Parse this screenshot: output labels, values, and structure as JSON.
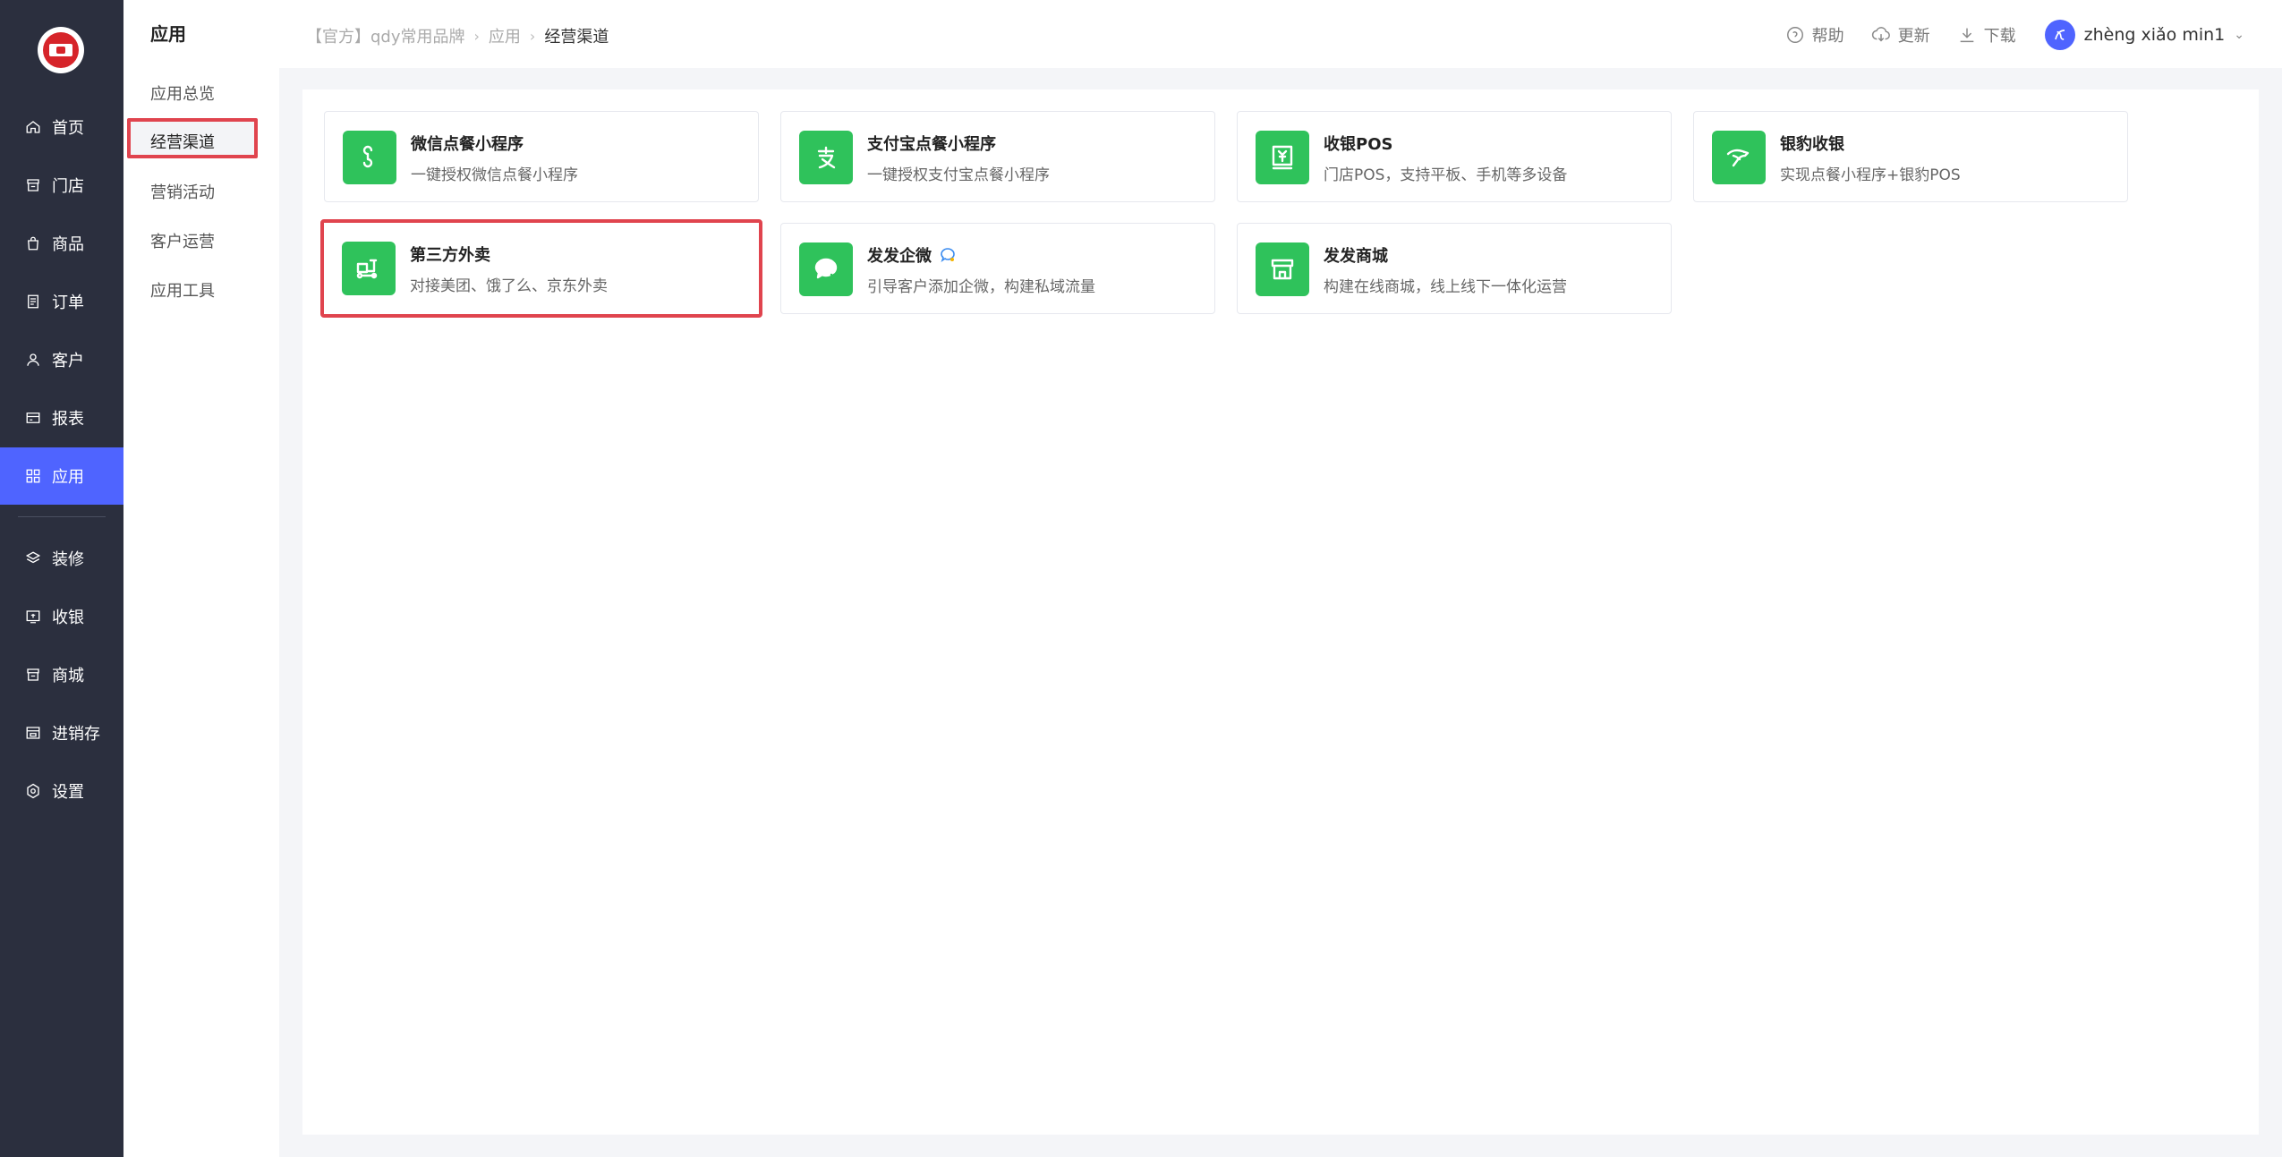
{
  "sidebar": {
    "items": [
      {
        "label": "首页",
        "icon": "home-icon"
      },
      {
        "label": "门店",
        "icon": "store-icon"
      },
      {
        "label": "商品",
        "icon": "bag-icon"
      },
      {
        "label": "订单",
        "icon": "order-icon"
      },
      {
        "label": "客户",
        "icon": "user-icon"
      },
      {
        "label": "报表",
        "icon": "report-icon"
      },
      {
        "label": "应用",
        "icon": "apps-icon"
      },
      {
        "label": "装修",
        "icon": "layers-icon"
      },
      {
        "label": "收银",
        "icon": "cashier-icon"
      },
      {
        "label": "商城",
        "icon": "mall-icon"
      },
      {
        "label": "进销存",
        "icon": "inventory-icon"
      },
      {
        "label": "设置",
        "icon": "settings-icon"
      }
    ],
    "active": "应用"
  },
  "subnav": {
    "title": "应用",
    "items": [
      "应用总览",
      "经营渠道",
      "营销活动",
      "客户运营",
      "应用工具"
    ],
    "active": "经营渠道"
  },
  "header": {
    "breadcrumb": [
      "【官方】qdy常用品牌",
      "应用",
      "经营渠道"
    ],
    "help": "帮助",
    "update": "更新",
    "download": "下载",
    "user": "zhèng xiǎo min1"
  },
  "cards": [
    {
      "title": "微信点餐小程序",
      "desc": "一键授权微信点餐小程序",
      "icon": "wechat-miniprogram-icon"
    },
    {
      "title": "支付宝点餐小程序",
      "desc": "一键授权支付宝点餐小程序",
      "icon": "alipay-icon"
    },
    {
      "title": "收银POS",
      "desc": "门店POS，支持平板、手机等多设备",
      "icon": "pos-icon"
    },
    {
      "title": "银豹收银",
      "desc": "实现点餐小程序+银豹POS",
      "icon": "leopard-icon"
    },
    {
      "title": "第三方外卖",
      "desc": "对接美团、饿了么、京东外卖",
      "icon": "delivery-scooter-icon"
    },
    {
      "title": "发发企微",
      "desc": "引导客户添加企微，构建私域流量",
      "icon": "wecom-chat-icon"
    },
    {
      "title": "发发商城",
      "desc": "构建在线商城，线上线下一体化运营",
      "icon": "shop-icon"
    }
  ],
  "colors": {
    "sidebar_bg": "#2b2f3e",
    "accent": "#4f64ff",
    "icon_green": "#2fc25b",
    "highlight_red": "#e0444e"
  }
}
